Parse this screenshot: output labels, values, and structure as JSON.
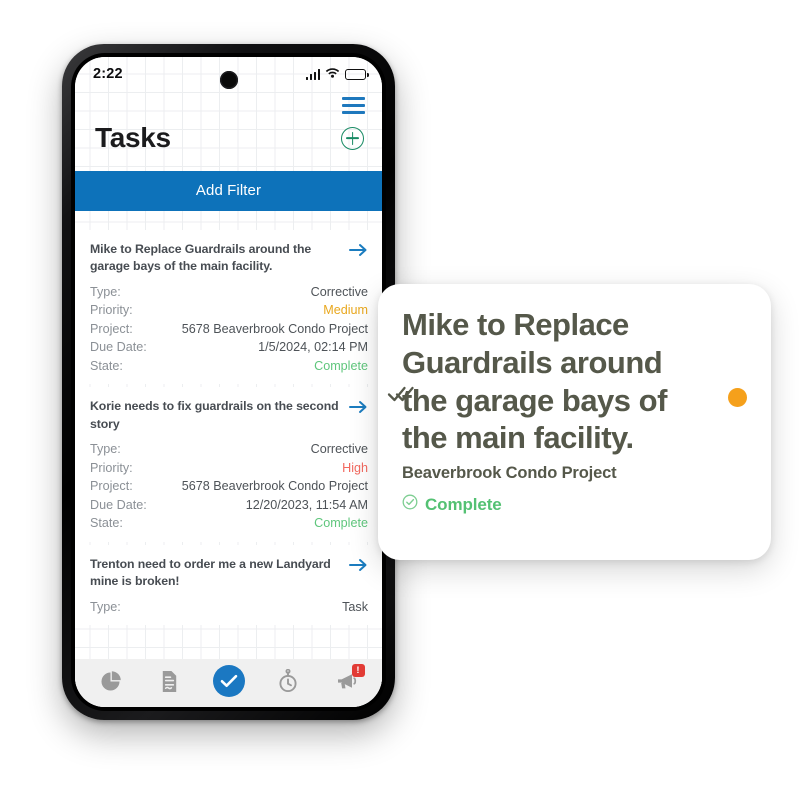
{
  "status_bar": {
    "time": "2:22",
    "cellular_icon": "cellular-signal-icon",
    "wifi_icon": "wifi-icon",
    "battery_icon": "battery-icon"
  },
  "header": {
    "menu_icon": "hamburger-menu-icon",
    "title": "Tasks",
    "add_icon": "plus-circle-icon"
  },
  "filter": {
    "label": "Add Filter"
  },
  "field_labels": {
    "type": "Type:",
    "priority": "Priority:",
    "project": "Project:",
    "due_date": "Due Date:",
    "state": "State:"
  },
  "tasks": [
    {
      "title": "Mike to Replace Guardrails around the garage bays of the main facility.",
      "type": "Corrective",
      "priority": "Medium",
      "priority_color": "#e9a81f",
      "project": "5678 Beaverbrook Condo Project",
      "due_date": "1/5/2024, 02:14 PM",
      "state": "Complete",
      "state_color": "#5fc67c",
      "arrow_icon": "arrow-right-icon"
    },
    {
      "title": "Korie needs to fix guardrails on the second story",
      "type": "Corrective",
      "priority": "High",
      "priority_color": "#f2695f",
      "project": "5678 Beaverbrook Condo Project",
      "due_date": "12/20/2023, 11:54 AM",
      "state": "Complete",
      "state_color": "#5fc67c",
      "arrow_icon": "arrow-right-icon"
    },
    {
      "title": "Trenton need to order me a new Landyard mine is broken!",
      "type": "Task",
      "arrow_icon": "arrow-right-icon"
    }
  ],
  "bottom_nav": {
    "items": [
      {
        "icon": "pie-chart-icon",
        "active": false
      },
      {
        "icon": "document-icon",
        "active": false
      },
      {
        "icon": "check-circle-icon",
        "active": true
      },
      {
        "icon": "stopwatch-icon",
        "active": false
      },
      {
        "icon": "megaphone-icon",
        "active": false,
        "badge": "!"
      }
    ],
    "active_color": "#1b78c2",
    "badge_color": "#e23b35"
  },
  "callout": {
    "title": "Mike to Replace Guardrails around the garage bays of the main facility.",
    "project": "Beaverbrook Condo Project",
    "status": "Complete",
    "status_icon": "check-circle-outline-icon",
    "double_check_icon": "double-check-icon",
    "dot_icon": "orange-dot-indicator",
    "dot_color": "#f5a01b",
    "status_color": "#54c173",
    "text_color": "#55584a"
  },
  "colors": {
    "primary_blue": "#0d72ba",
    "menu_blue": "#1e78bd",
    "green_accent": "#178a63"
  }
}
